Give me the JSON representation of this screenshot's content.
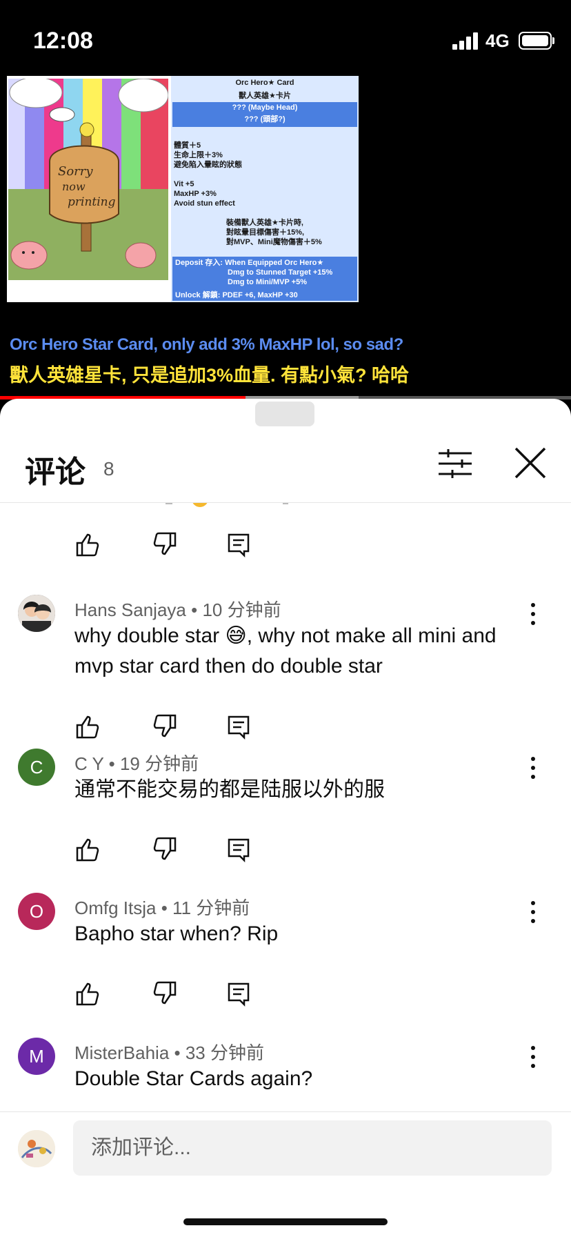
{
  "status_bar": {
    "time": "12:08",
    "network": "4G"
  },
  "video": {
    "card_panel": {
      "title_en": "Orc Hero★ Card",
      "title_zh": "獸人英雄★卡片",
      "slot_en": "??? (Maybe Head)",
      "slot_zh": "??? (頭部?)",
      "stats_zh": [
        "體質＋5",
        "生命上限＋3%",
        "避免陷入暈眩的狀態"
      ],
      "stats_en": [
        "Vit +5",
        "MaxHP +3%",
        "Avoid stun effect"
      ],
      "equip_zh": [
        "裝備獸人英雄★卡片時,",
        "對眩暈目標傷害＋15%,",
        "對MVP、Mini魔物傷害＋5%"
      ],
      "deposit": [
        "Deposit 存入: When Equipped Orc Hero★",
        "Dmg to Stunned Target +15%",
        "Dmg to Mini/MVP +5%"
      ],
      "unlock": "Unlock 解鎖: PDEF +6, MaxHP +30"
    },
    "art_sign_text": "Sorry now printing",
    "caption_en": "Orc Hero Star Card, only add 3% MaxHP lol, so sad?",
    "caption_zh": "獸人英雄星卡, 只是追加3%血量. 有點小氣? 哈哈",
    "progress": 0.43
  },
  "comments_panel": {
    "title": "评论",
    "count": "8",
    "comments": [
      {
        "author": "Hans Sanjaya",
        "time": "10 分钟前",
        "text": "why double star 😅, why not make all mini and mvp star card then do double star",
        "avatar_letter": "",
        "avatar_color": "#3a3a3a"
      },
      {
        "author": "C Y",
        "time": "19 分钟前",
        "text": "通常不能交易的都是陆服以外的服",
        "avatar_letter": "C",
        "avatar_color": "#3f7a2e"
      },
      {
        "author": "Omfg Itsja",
        "time": "11 分钟前",
        "text": "Bapho star when? Rip",
        "avatar_letter": "O",
        "avatar_color": "#b8285a"
      },
      {
        "author": "MisterBahia",
        "time": "33 分钟前",
        "text": "Double Star Cards again?",
        "avatar_letter": "M",
        "avatar_color": "#6c2aa8"
      }
    ],
    "composer_placeholder": "添加评论..."
  }
}
